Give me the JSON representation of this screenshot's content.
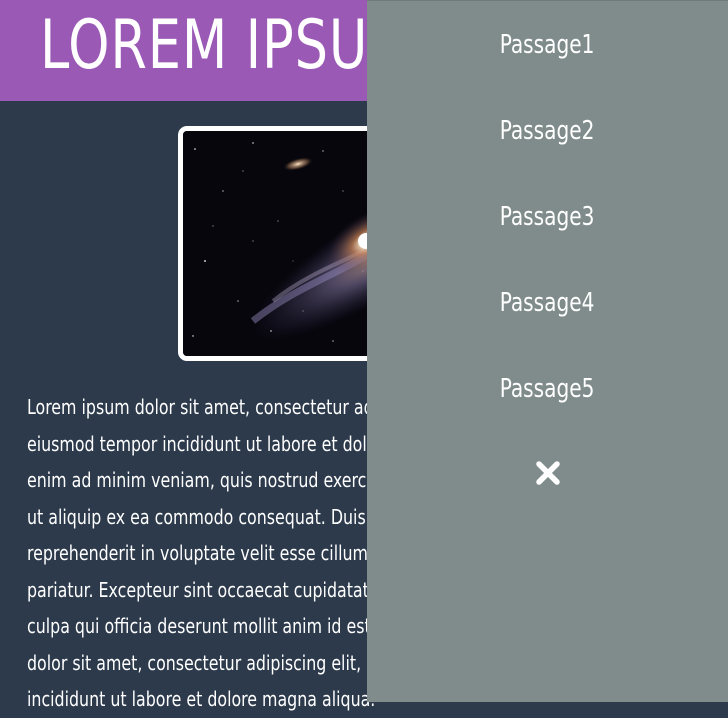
{
  "header": {
    "title": "LOREM IPSUM"
  },
  "hero_image": {
    "description_icon": "galaxy-image"
  },
  "article": {
    "text": "Lorem ipsum dolor sit amet, consectetur adipiscing elit, sed do\neiusmod tempor incididunt ut labore et dolore magna aliqua. Ut\nenim ad minim veniam, quis nostrud exercitation ullamco laboris nisi\nut aliquip ex ea commodo consequat. Duis aute irure dolor in\nreprehenderit in voluptate velit esse cillum dolore eu fugiat nulla\npariatur. Excepteur sint occaecat cupidatat non proident, sunt in\nculpa qui officia deserunt mollit anim id est laborum. Lorem ipsum\ndolor sit amet, consectetur adipiscing elit, sed do eiusmod tempor\nincididunt ut labore et dolore magna aliqua."
  },
  "side_nav": {
    "items": [
      {
        "label": "Passage1"
      },
      {
        "label": "Passage2"
      },
      {
        "label": "Passage3"
      },
      {
        "label": "Passage4"
      },
      {
        "label": "Passage5"
      }
    ],
    "close_icon": "close-icon"
  },
  "colors": {
    "header_bg": "#9b59b6",
    "page_bg": "#2c3a4c",
    "nav_bg": "#7f8c8b",
    "text": "#ffffff"
  }
}
